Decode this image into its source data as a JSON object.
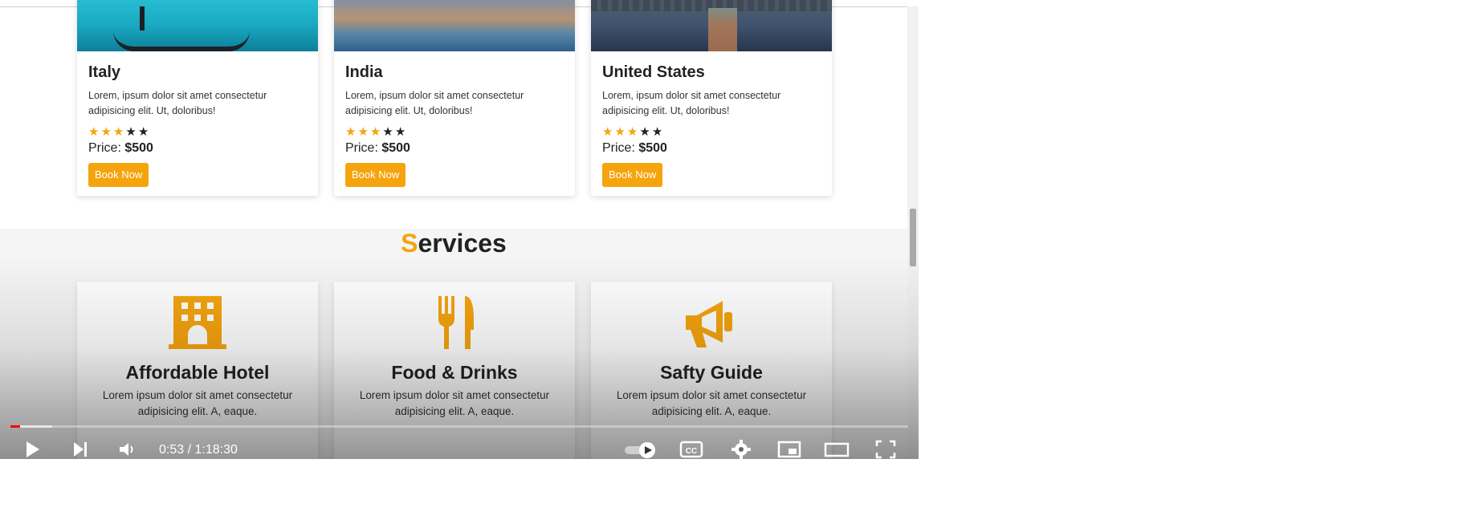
{
  "destinations": [
    {
      "name": "Italy",
      "desc": "Lorem, ipsum dolor sit amet consectetur adipisicing elit. Ut, doloribus!",
      "rating": 3,
      "price_label": "Price:",
      "price": "$500",
      "button": "Book Now"
    },
    {
      "name": "India",
      "desc": "Lorem, ipsum dolor sit amet consectetur adipisicing elit. Ut, doloribus!",
      "rating": 3,
      "price_label": "Price:",
      "price": "$500",
      "button": "Book Now"
    },
    {
      "name": "United States",
      "desc": "Lorem, ipsum dolor sit amet consectetur adipisicing elit. Ut, doloribus!",
      "rating": 3,
      "price_label": "Price:",
      "price": "$500",
      "button": "Book Now"
    }
  ],
  "services": {
    "title_first": "S",
    "title_rest": "ervices",
    "items": [
      {
        "title": "Affordable Hotel",
        "desc": "Lorem ipsum dolor sit amet consectetur adipisicing elit. A, eaque.",
        "icon": "hotel-icon"
      },
      {
        "title": "Food & Drinks",
        "desc": "Lorem ipsum dolor sit amet consectetur adipisicing elit. A, eaque.",
        "icon": "utensils-icon"
      },
      {
        "title": "Safty Guide",
        "desc": "Lorem ipsum dolor sit amet consectetur adipisicing elit. A, eaque.",
        "icon": "megaphone-icon"
      }
    ]
  },
  "player": {
    "time": "0:53 / 1:18:30",
    "played_fraction": 0.011,
    "buffered_fraction": 0.047
  },
  "colors": {
    "accent": "#f5a40e",
    "progress": "#ff0000"
  }
}
